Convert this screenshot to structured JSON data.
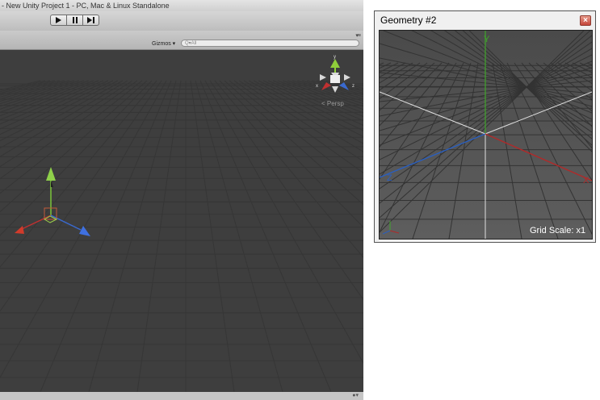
{
  "unity": {
    "title": "- New Unity Project 1 - PC, Mac & Linux Standalone",
    "toolbar": {
      "play_icon": "play-icon",
      "pause_icon": "pause-icon",
      "step_icon": "step-icon"
    },
    "scene_bar": {
      "gizmos_label": "Gizmos ▾",
      "search_placeholder": "Q▾All"
    },
    "scene": {
      "projection_label": "< Persp",
      "gizmo_axes": {
        "x": "x",
        "y": "y",
        "z": "z"
      }
    }
  },
  "geometry_window": {
    "title": "Geometry #2",
    "close_icon": "close-icon",
    "axes": {
      "y": "Y",
      "z": "Z",
      "x": "X"
    },
    "grid_scale": "Grid Scale: x1"
  },
  "colors": {
    "x_axis": "#b02a2a",
    "y_axis": "#4fb02c",
    "z_axis": "#2a5fc0",
    "scene_bg": "#3e3e3e",
    "viewport_bg": "#595959",
    "grid_line": "#2f2f2f"
  }
}
